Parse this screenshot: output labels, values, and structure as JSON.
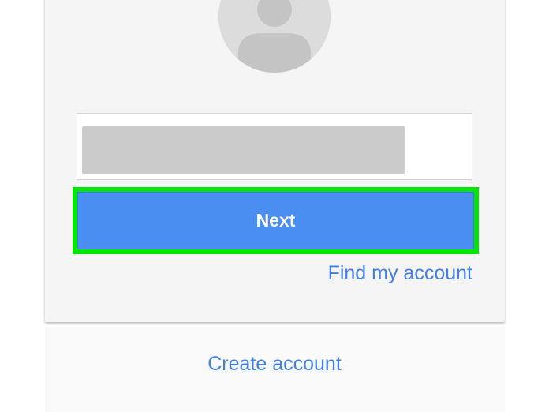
{
  "signin": {
    "email_field": {
      "value": "",
      "placeholder": ""
    },
    "next_label": "Next",
    "find_account_label": "Find my account",
    "create_account_label": "Create account"
  },
  "colors": {
    "primary_button": "#4b8ef1",
    "link": "#427fed",
    "highlight": "#00e600",
    "card_background": "#f5f5f5"
  },
  "icons": {
    "avatar": "default-user-avatar-icon"
  }
}
